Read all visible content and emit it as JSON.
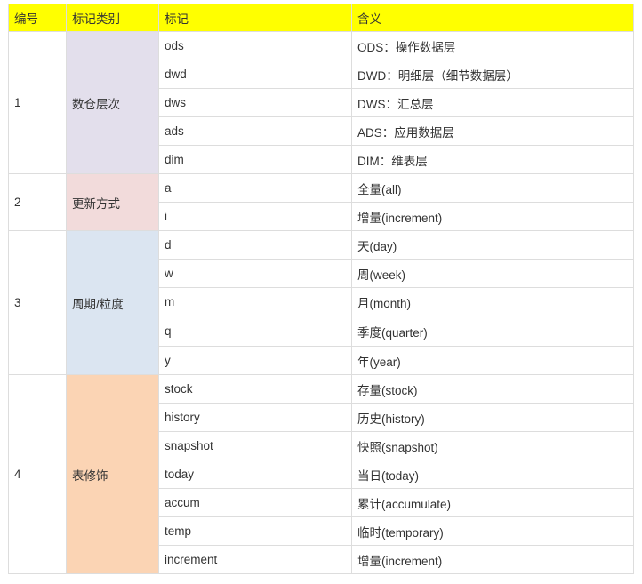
{
  "headers": {
    "num": "编号",
    "category": "标记类别",
    "mark": "标记",
    "meaning": "含义"
  },
  "groups": [
    {
      "num": "1",
      "category": "数仓层次",
      "color": "#e3dfec",
      "rows": [
        {
          "mark": "ods",
          "meaning": "ODS：操作数据层"
        },
        {
          "mark": "dwd",
          "meaning": "DWD：明细层（细节数据层）"
        },
        {
          "mark": "dws",
          "meaning": "DWS：汇总层"
        },
        {
          "mark": "ads",
          "meaning": "ADS：应用数据层"
        },
        {
          "mark": "dim",
          "meaning": "DIM：维表层"
        }
      ]
    },
    {
      "num": "2",
      "category": "更新方式",
      "color": "#f2dbdb",
      "rows": [
        {
          "mark": "a",
          "meaning": "全量(all)"
        },
        {
          "mark": "i",
          "meaning": "增量(increment)"
        }
      ]
    },
    {
      "num": "3",
      "category": "周期/粒度",
      "color": "#dbe5f1",
      "rows": [
        {
          "mark": "d",
          "meaning": "天(day)"
        },
        {
          "mark": "w",
          "meaning": "周(week)"
        },
        {
          "mark": "m",
          "meaning": "月(month)"
        },
        {
          "mark": "q",
          "meaning": "季度(quarter)"
        },
        {
          "mark": "y",
          "meaning": "年(year)"
        }
      ]
    },
    {
      "num": "4",
      "category": "表修饰",
      "color": "#fbd4b4",
      "rows": [
        {
          "mark": "stock",
          "meaning": "存量(stock)"
        },
        {
          "mark": "history",
          "meaning": "历史(history)"
        },
        {
          "mark": "snapshot",
          "meaning": "快照(snapshot)"
        },
        {
          "mark": "today",
          "meaning": "当日(today)"
        },
        {
          "mark": "accum",
          "meaning": "累计(accumulate)"
        },
        {
          "mark": "temp",
          "meaning": "临时(temporary)"
        },
        {
          "mark": "increment",
          "meaning": "增量(increment)"
        }
      ]
    }
  ]
}
